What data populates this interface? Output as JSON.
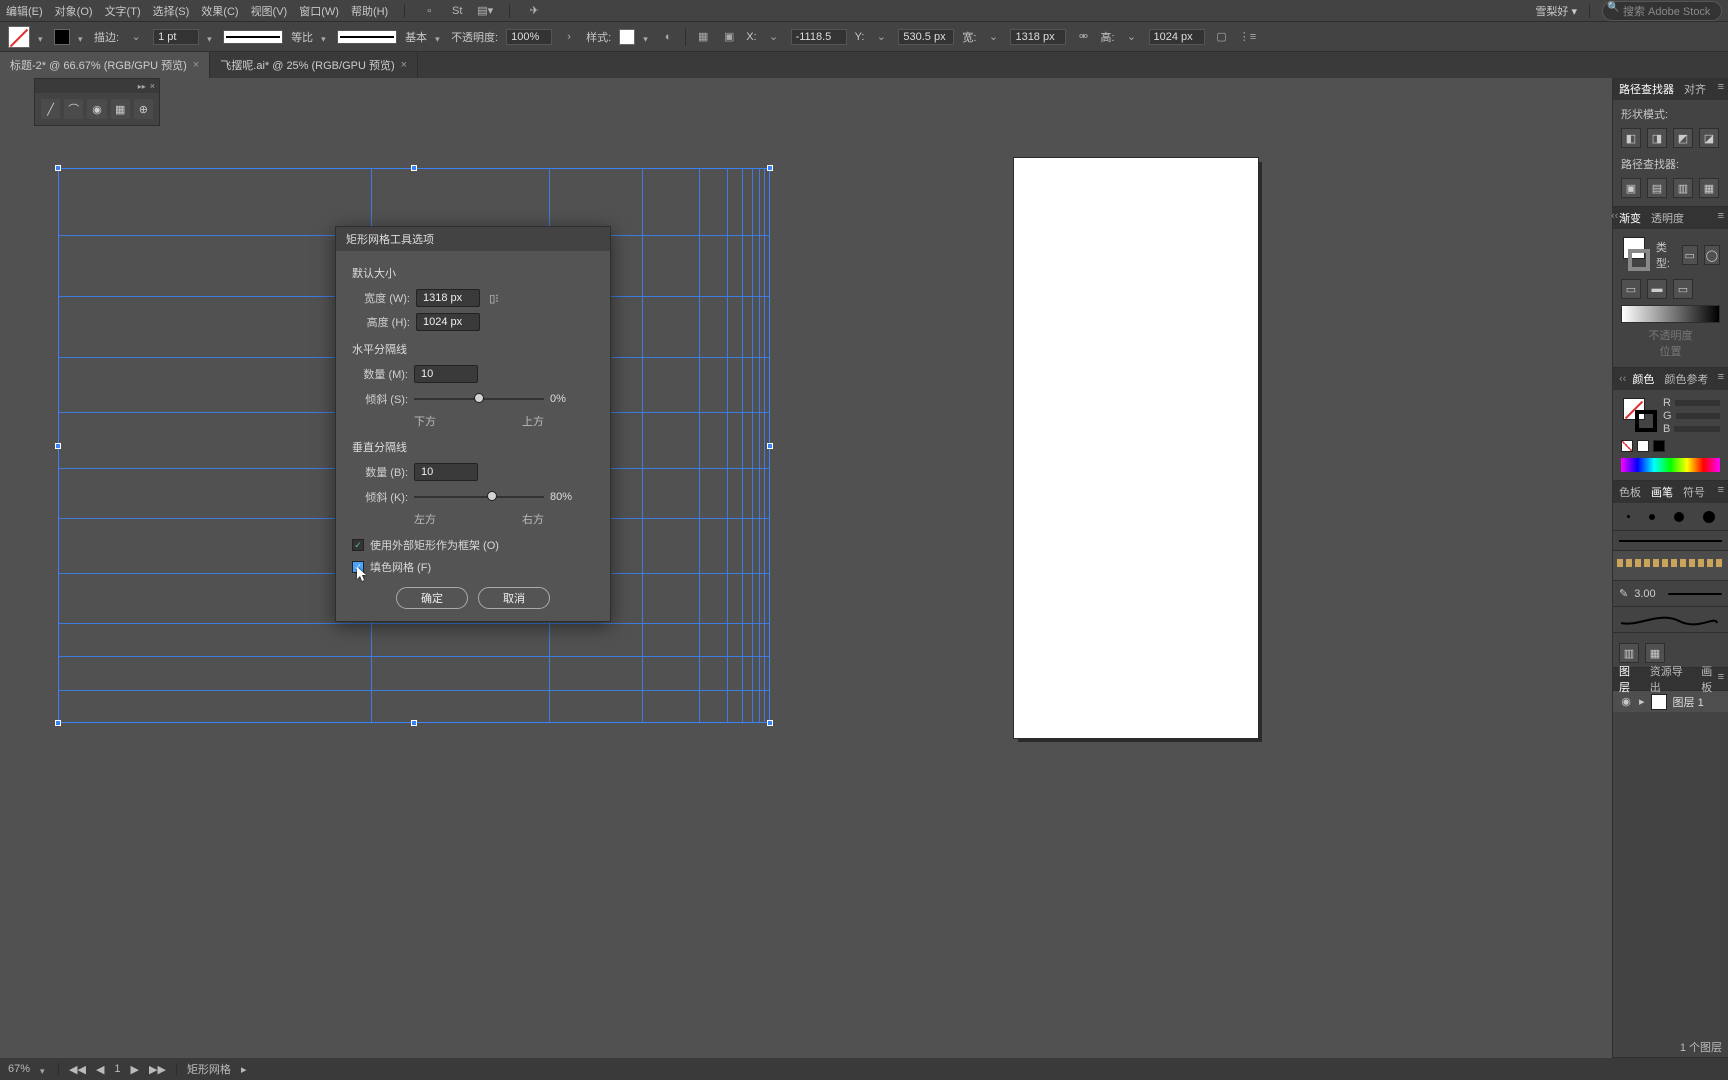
{
  "menu": {
    "items": [
      "编辑(E)",
      "对象(O)",
      "文字(T)",
      "选择(S)",
      "效果(C)",
      "视图(V)",
      "窗口(W)",
      "帮助(H)"
    ],
    "user": "雪梨好 ▾",
    "search_placeholder": "搜索 Adobe Stock"
  },
  "control": {
    "stroke_label": "描边:",
    "stroke_weight": "1 pt",
    "stroke_var": "等比",
    "profile": "基本",
    "opacity_label": "不透明度:",
    "opacity": "100%",
    "style_label": "样式:",
    "x_label": "X:",
    "x": "-1118.5 ",
    "y_label": "Y:",
    "y": "530.5 px",
    "w_label": "宽:",
    "w": "1318 px",
    "h_label": "高:",
    "h": "1024 px"
  },
  "tabs": [
    {
      "label": "标题-2* @ 66.67% (RGB/GPU 预览)",
      "active": true
    },
    {
      "label": "飞摆呢.ai* @ 25% (RGB/GPU 预览)",
      "active": false
    }
  ],
  "dialog": {
    "title": "矩形网格工具选项",
    "sec_default": "默认大小",
    "width_label": "宽度 (W):",
    "width": "1318 px",
    "height_label": "高度 (H):",
    "height": "1024 px",
    "sec_horiz": "水平分隔线",
    "count_h_label": "数量 (M):",
    "count_h": "10",
    "skew_h_label": "倾斜 (S):",
    "skew_h_val": "0%",
    "skew_h_left": "下方",
    "skew_h_right": "上方",
    "sec_vert": "垂直分隔线",
    "count_v_label": "数量 (B):",
    "count_v": "10",
    "skew_v_label": "倾斜 (K):",
    "skew_v_val": "80%",
    "skew_v_left": "左方",
    "skew_v_right": "右方",
    "check_frame": "使用外部矩形作为框架 (O)",
    "check_fill": "填色网格 (F)",
    "ok": "确定",
    "cancel": "取消"
  },
  "rightpanels": {
    "pathfinder_tab": "路径查找器",
    "align_tab": "对齐",
    "shape_modes": "形状模式:",
    "pathfinders": "路径查找器:",
    "gradient_tab": "渐变",
    "transparency_tab": "透明度",
    "type_label": "类型:",
    "opacity_disabled": "不透明度",
    "position_disabled": "位置",
    "color_tab": "颜色",
    "colorguide_tab": "颜色参考",
    "r": "R",
    "g": "G",
    "b": "B",
    "swatches_tab": "色板",
    "brushes_tab": "画笔",
    "symbols_tab": "符号",
    "brush_val": "3.00",
    "layers_tab": "图层",
    "assets_tab": "资源导出",
    "artboards_tab": "画板",
    "layer1": "图层 1",
    "layer_count": "1 个图层"
  },
  "status": {
    "zoom": "67%",
    "nav": "1",
    "tool": "矩形网格"
  }
}
